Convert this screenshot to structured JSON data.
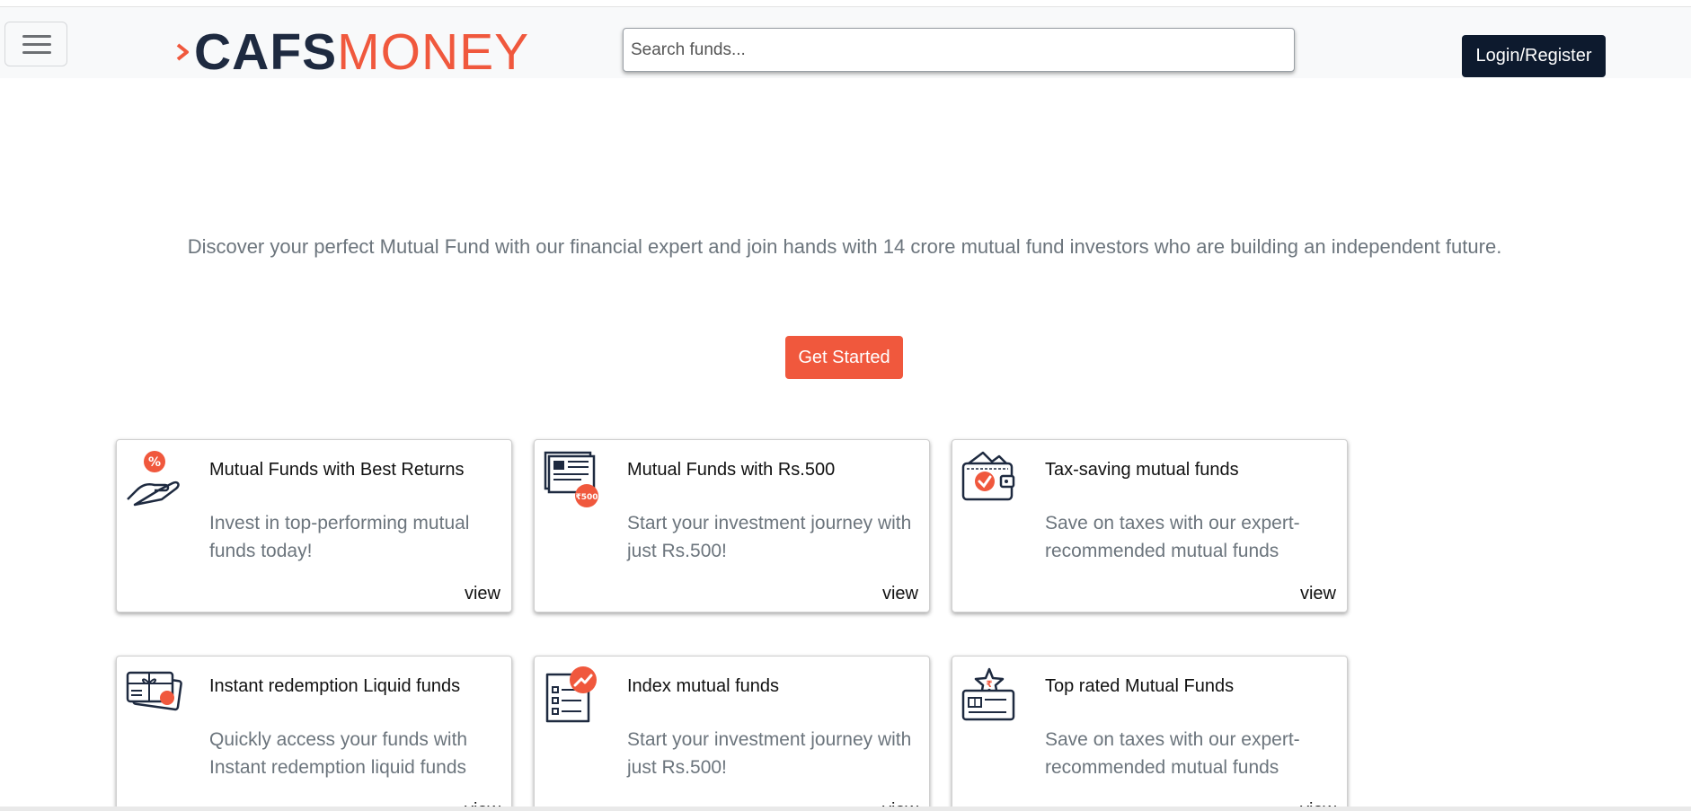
{
  "header": {
    "logo_left": "CAFS",
    "logo_right": "MONEY",
    "search_placeholder": "Search funds...",
    "login_label": "Login/Register"
  },
  "hero": {
    "text": "Discover your perfect Mutual Fund with our financial expert and join hands with 14 crore mutual fund investors who are building an independent future.",
    "cta_label": "Get Started"
  },
  "cards": [
    {
      "title": "Mutual Funds with Best Returns",
      "desc": "Invest in top-performing mutual funds today!",
      "link": "view",
      "icon": "hand-percent-icon"
    },
    {
      "title": "Mutual Funds with Rs.500",
      "desc": "Start your investment journey with just Rs.500!",
      "link": "view",
      "icon": "document-rupee-icon"
    },
    {
      "title": "Tax-saving mutual funds",
      "desc": "Save on taxes with our expert-recommended mutual funds",
      "link": "view",
      "icon": "wallet-check-icon"
    },
    {
      "title": "Instant redemption Liquid funds",
      "desc": "Quickly access your funds with Instant redemption liquid funds",
      "link": "view",
      "icon": "gift-card-icon"
    },
    {
      "title": "Index mutual funds",
      "desc": "Start your investment journey with just Rs.500!",
      "link": "view",
      "icon": "checklist-chart-icon"
    },
    {
      "title": "Top rated Mutual Funds",
      "desc": "Save on taxes with our expert-recommended mutual funds",
      "link": "view",
      "icon": "star-card-icon"
    }
  ],
  "colors": {
    "brand_dark": "#1e2a40",
    "brand_accent": "#f0583d",
    "button_dark": "#0d1a2e"
  }
}
